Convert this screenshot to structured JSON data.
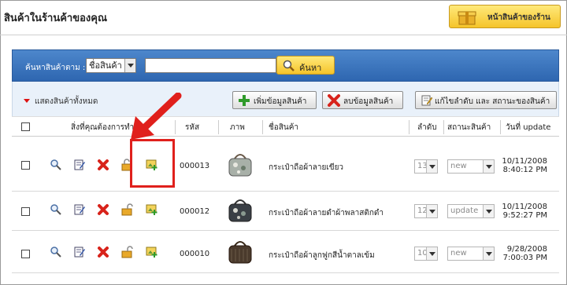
{
  "header": {
    "title": "สินค้าในร้านค้าของคุณ",
    "store_button": "หน้าสินค้าของร้าน"
  },
  "search": {
    "label": "ค้นหาสินค้าตาม :",
    "field_selected": "ชื่อสินค้า",
    "query_value": "",
    "button": "ค้นหา"
  },
  "toolbar": {
    "show_all": "แสดงสินค้าทั้งหมด",
    "add_button": "เพิ่มข้อมูลสินค้า",
    "delete_button": "ลบข้อมูลสินค้า",
    "edit_order_button": "แก้ไขลำดับ และ สถานะของสินค้า"
  },
  "table": {
    "headers": {
      "actions": "สิ่งที่คุณต้องการทำ?",
      "code": "รหัส",
      "image": "ภาพ",
      "name": "ชื่อสินค้า",
      "order": "ลำดับ",
      "status": "สถานะสินค้า",
      "updated": "วันที่ update"
    },
    "rows": [
      {
        "code": "000013",
        "name": "กระเป๋าถือผ้าลายเขียว",
        "order": "13",
        "status": "new",
        "date": "10/11/2008",
        "time": "8:40:12 PM"
      },
      {
        "code": "000012",
        "name": "กระเป๋าถือผ้าลายดำผ้าพลาสติกดำ",
        "order": "12",
        "status": "update",
        "date": "10/11/2008",
        "time": "9:52:27 PM"
      },
      {
        "code": "000010",
        "name": "กระเป๋าถือผ้าลูกฟูกสีน้ำตาลเข้ม",
        "order": "10",
        "status": "new",
        "date": "9/28/2008",
        "time": "7:00:03 PM"
      }
    ]
  },
  "icons": {
    "view": "magnifier-icon",
    "edit": "edit-note-icon",
    "delete": "red-x-icon",
    "lock": "lock-icon",
    "add_image": "add-image-icon"
  },
  "colors": {
    "search_bar": "#3a72bd",
    "toolbar_bg": "#e9f1fa",
    "highlight": "#e0201c",
    "button_yellow": "#f5c42a"
  }
}
